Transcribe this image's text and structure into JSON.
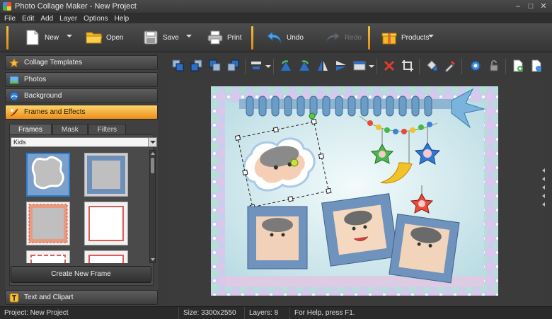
{
  "window": {
    "title": "Photo Collage Maker - New Project",
    "controls": [
      "–",
      "□",
      "✕"
    ]
  },
  "menu": [
    "File",
    "Edit",
    "Add",
    "Layer",
    "Options",
    "Help"
  ],
  "toolbar": {
    "new_label": "New",
    "open_label": "Open",
    "save_label": "Save",
    "print_label": "Print",
    "undo_label": "Undo",
    "redo_label": "Redo",
    "products_label": "Products"
  },
  "sidebar": {
    "sections": [
      {
        "label": "Collage Templates",
        "icon": "star-icon"
      },
      {
        "label": "Photos",
        "icon": "photos-icon"
      },
      {
        "label": "Background",
        "icon": "background-icon"
      },
      {
        "label": "Frames and Effects",
        "icon": "frames-effects-icon",
        "active": true
      }
    ],
    "tabs": [
      "Frames",
      "Mask",
      "Filters"
    ],
    "active_tab": "Frames",
    "category_value": "Kids",
    "create_button": "Create New Frame",
    "bottom_section": {
      "label": "Text and Clipart",
      "icon": "text-icon"
    }
  },
  "status": {
    "project": "Project: New Project",
    "size": "Size: 3300x2550",
    "layers": "Layers: 8",
    "help": "For Help, press F1."
  },
  "colors": {
    "accent": "#f0a32a",
    "selection": "#2e7bd6",
    "panel": "#404040"
  }
}
